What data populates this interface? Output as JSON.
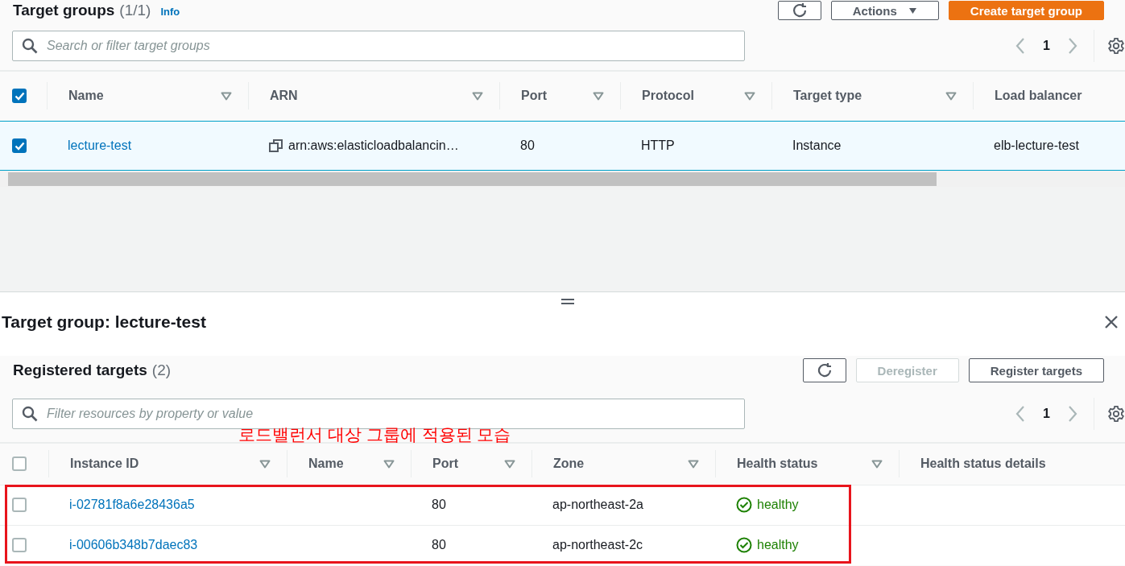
{
  "target_groups": {
    "title": "Target groups",
    "count": "(1/1)",
    "info": "Info",
    "buttons": [
      {
        "kind": "refresh"
      },
      {
        "kind": "dropdown",
        "label": "Actions"
      },
      {
        "kind": "primary",
        "label": "Create target group"
      }
    ],
    "search": {
      "placeholder": "Search or filter target groups"
    },
    "pagination": {
      "page": "1"
    },
    "all_checked": true,
    "columns": [
      {
        "label": "Name",
        "kind": "link",
        "sortable": true
      },
      {
        "label": "ARN",
        "kind": "arn",
        "sortable": true
      },
      {
        "label": "Port",
        "kind": "text",
        "sortable": true
      },
      {
        "label": "Protocol",
        "kind": "text",
        "sortable": true
      },
      {
        "label": "Target type",
        "kind": "text",
        "sortable": true
      },
      {
        "label": "Load balancer",
        "kind": "text",
        "sortable": false
      }
    ],
    "rows": [
      {
        "selected": true,
        "cells": [
          "lecture-test",
          "arn:aws:elasticloadbalancin…",
          "80",
          "HTTP",
          "Instance",
          "elb-lecture-test"
        ]
      }
    ]
  },
  "details": {
    "title": "Target group: lecture-test",
    "registered": {
      "title": "Registered targets",
      "count": "(2)",
      "buttons": [
        {
          "kind": "refresh"
        },
        {
          "kind": "default",
          "label": "Deregister",
          "disabled": true
        },
        {
          "kind": "default",
          "label": "Register targets",
          "disabled": false
        }
      ],
      "search": {
        "placeholder": "Filter resources by property or value"
      },
      "pagination": {
        "page": "1"
      },
      "annotation": {
        "text": "로드밸런서 대상 그룹에 적용된 모습"
      },
      "all_checked": false,
      "columns": [
        {
          "label": "Instance ID",
          "kind": "link",
          "sortable": true
        },
        {
          "label": "Name",
          "kind": "text",
          "sortable": true
        },
        {
          "label": "Port",
          "kind": "text",
          "sortable": true
        },
        {
          "label": "Zone",
          "kind": "text",
          "sortable": true
        },
        {
          "label": "Health status",
          "kind": "health",
          "sortable": true
        },
        {
          "label": "Health status details",
          "kind": "text",
          "sortable": false
        }
      ],
      "rows": [
        {
          "selected": false,
          "cells": [
            "i-02781f8a6e28436a5",
            "",
            "80",
            "ap-northeast-2a",
            "healthy",
            ""
          ]
        },
        {
          "selected": false,
          "cells": [
            "i-00606b348b7daec83",
            "",
            "80",
            "ap-northeast-2c",
            "healthy",
            ""
          ]
        }
      ]
    }
  }
}
